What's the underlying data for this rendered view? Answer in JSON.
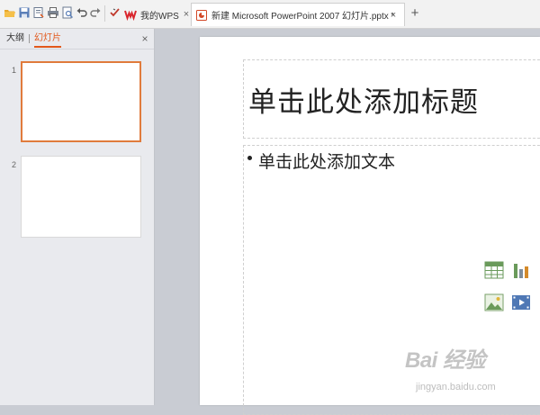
{
  "quick_access": {
    "icons": [
      "open-folder-icon",
      "save-icon",
      "save-as-icon",
      "print-icon",
      "print-preview-icon",
      "undo-icon",
      "redo-icon",
      "format-painter-icon"
    ]
  },
  "tabs": [
    {
      "label": "我的WPS",
      "icon": "wps-logo-icon",
      "active": false
    },
    {
      "label": "新建 Microsoft PowerPoint 2007 幻灯片.pptx *",
      "icon": "presentation-file-icon",
      "active": true
    }
  ],
  "close_glyph": "×",
  "new_tab_glyph": "+",
  "panel": {
    "tab_outline": "大纲",
    "tab_slides": "幻灯片",
    "close_glyph": "×",
    "slides": [
      {
        "number": "1",
        "selected": true
      },
      {
        "number": "2",
        "selected": false
      }
    ]
  },
  "slide": {
    "title_placeholder": "单击此处添加标题",
    "body_placeholder": "单击此处添加文本",
    "insert_icons": [
      "insert-table-icon",
      "insert-chart-icon",
      "insert-picture-icon",
      "insert-media-icon"
    ]
  },
  "watermark": {
    "logo_text": "Bai 经验",
    "url": "jingyan.baidu.com"
  },
  "colors": {
    "accent": "#e2581b",
    "selected_thumb_border": "#e07b3c",
    "workspace_bg": "#c9ccd3"
  }
}
